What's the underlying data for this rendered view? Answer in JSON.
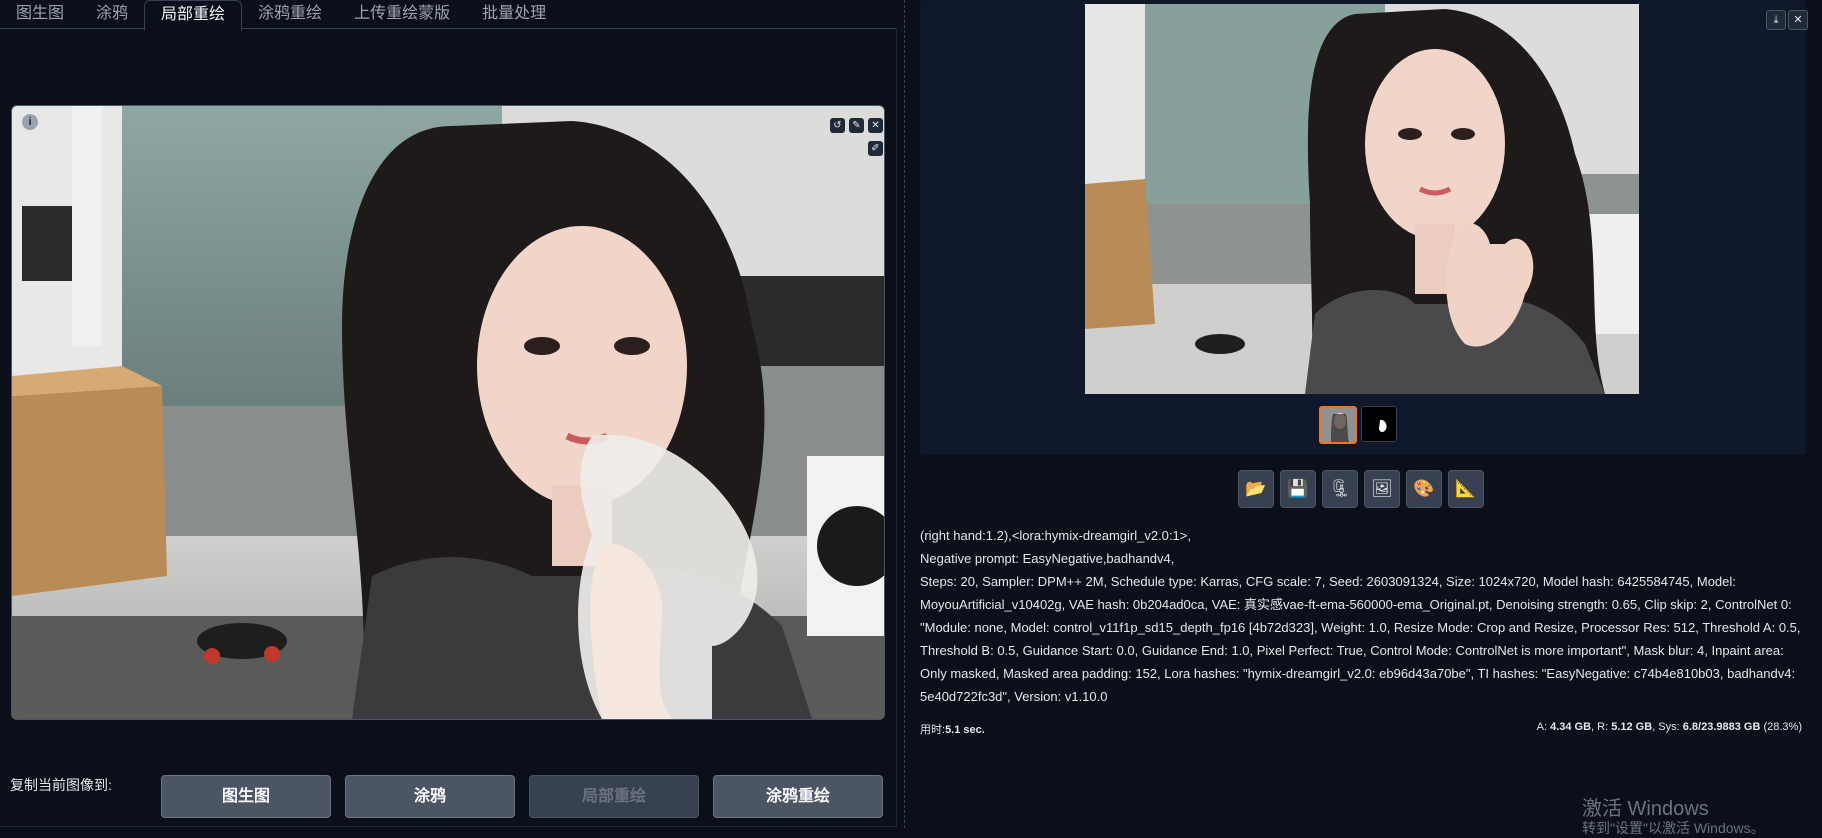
{
  "tabs": [
    "图生图",
    "涂鸦",
    "局部重绘",
    "涂鸦重绘",
    "上传重绘蒙版",
    "批量处理"
  ],
  "active_tab_index": 2,
  "canvas": {
    "info_icon": "info-icon",
    "tools": [
      "undo-icon",
      "brush-icon",
      "close-icon",
      "brush-color-icon"
    ]
  },
  "copy": {
    "label": "复制当前图像到:",
    "buttons": [
      "图生图",
      "涂鸦",
      "局部重绘",
      "涂鸦重绘"
    ],
    "disabled_index": 2
  },
  "gallery": {
    "top_icons": [
      "download-icon",
      "close-icon"
    ],
    "thumbnails": [
      "thumbnail-image",
      "thumbnail-mask"
    ],
    "selected_thumb": 0
  },
  "toolbar": [
    {
      "name": "folder-button",
      "glyph": "📂"
    },
    {
      "name": "save-button",
      "glyph": "💾"
    },
    {
      "name": "zip-button",
      "glyph": "🗜"
    },
    {
      "name": "send-to-img2img-button",
      "glyph": "🖼"
    },
    {
      "name": "send-to-inpaint-button",
      "glyph": "🎨"
    },
    {
      "name": "send-to-extras-button",
      "glyph": "📐"
    }
  ],
  "generation_info": [
    "(right hand:1.2),<lora:hymix-dreamgirl_v2.0:1>,",
    "Negative prompt: EasyNegative,badhandv4,",
    "Steps: 20, Sampler: DPM++ 2M, Schedule type: Karras, CFG scale: 7, Seed: 2603091324, Size: 1024x720, Model hash: 6425584745, Model:",
    "MoyouArtificial_v10402g, VAE hash: 0b204ad0ca, VAE: 真实感vae-ft-ema-560000-ema_Original.pt, Denoising strength: 0.65, Clip skip: 2, ControlNet 0:",
    "\"Module: none, Model: control_v11f1p_sd15_depth_fp16 [4b72d323], Weight: 1.0, Resize Mode: Crop and Resize, Processor Res: 512, Threshold A: 0.5,",
    "Threshold B: 0.5, Guidance Start: 0.0, Guidance End: 1.0, Pixel Perfect: True, Control Mode: ControlNet is more important\", Mask blur: 4, Inpaint area:",
    "Only masked, Masked area padding: 152, Lora hashes: \"hymix-dreamgirl_v2.0: eb96d43a70be\", TI hashes: \"EasyNegative: c74b4e810b03, badhandv4:",
    "5e40d722fc3d\", Version: v1.10.0"
  ],
  "stats": {
    "time_label": "用时:",
    "time_value": "5.1 sec.",
    "mem_a_label": "A: ",
    "mem_a": "4.34 GB",
    "mem_r_label": ", R: ",
    "mem_r": "5.12 GB",
    "mem_sys_label": ", Sys: ",
    "mem_sys": "6.8/23.9883 GB",
    "mem_pct": " (28.3%)"
  },
  "watermark": {
    "line1": "激活 Windows",
    "line2": "转到\"设置\"以激活 Windows。"
  }
}
